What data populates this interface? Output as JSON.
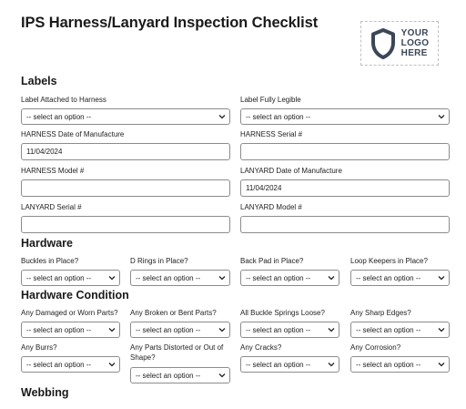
{
  "header": {
    "title": "IPS Harness/Lanyard Inspection Checklist",
    "logo_lines": [
      "YOUR",
      "LOGO",
      "HERE"
    ]
  },
  "placeholder": "-- select an option --",
  "sections": {
    "labels": "Labels",
    "hardware": "Hardware",
    "hardware_condition": "Hardware Condition",
    "webbing": "Webbing"
  },
  "labels_section": {
    "label_attached": "Label Attached to Harness",
    "label_legible": "Label Fully Legible",
    "harness_date_label": "HARNESS Date of Manufacture",
    "harness_date_value": "11/04/2024",
    "harness_serial_label": "HARNESS Serial #",
    "harness_serial_value": "",
    "harness_model_label": "HARNESS Model #",
    "harness_model_value": "",
    "lanyard_date_label": "LANYARD Date of Manufacture",
    "lanyard_date_value": "11/04/2024",
    "lanyard_serial_label": "LANYARD Serial #",
    "lanyard_serial_value": "",
    "lanyard_model_label": "LANYARD Model #",
    "lanyard_model_value": ""
  },
  "hardware": {
    "buckles": "Buckles in Place?",
    "d_rings": "D Rings in Place?",
    "back_pad": "Back Pad in Place?",
    "loop_keepers": "Loop Keepers in Place?"
  },
  "hardware_condition": {
    "damaged_worn": "Any Damaged or Worn Parts?",
    "broken_bent": "Any Broken or Bent Parts?",
    "buckle_springs": "All Buckle Springs Loose?",
    "sharp_edges": "Any Sharp Edges?",
    "burrs": "Any Burrs?",
    "distorted": "Any Parts Distorted or Out of Shape?",
    "cracks": "Any Cracks?",
    "corrosion": "Any Corrosion?"
  },
  "colors": {
    "text": "#1a1a1a",
    "border": "#8c8c8c",
    "logo": "#3c4658"
  }
}
